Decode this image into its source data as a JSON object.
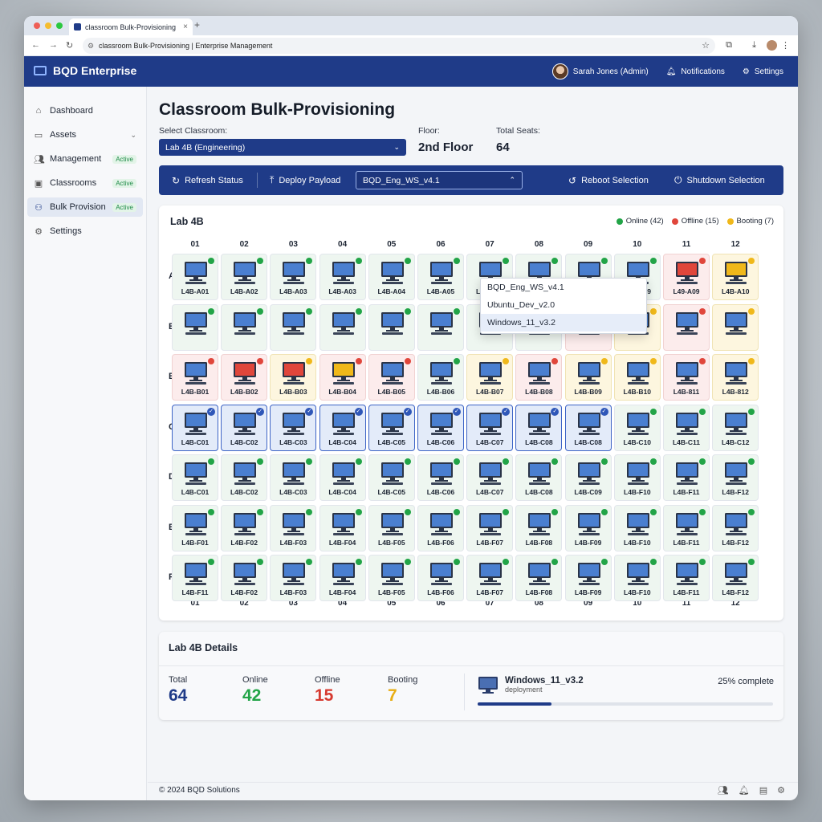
{
  "browser": {
    "tab_title": "classroom Bulk-Provisioning",
    "tab_close": "×",
    "new_tab": "+",
    "url": "classroom Bulk-Provisioning | Enterprise Management"
  },
  "header": {
    "brand": "BQD Enterprise",
    "user": "Sarah Jones (Admin)",
    "notifications": "Notifications",
    "settings": "Settings"
  },
  "sidebar": {
    "items": [
      {
        "label": "Dashboard",
        "icon": "home-icon",
        "badge": ""
      },
      {
        "label": "Assets",
        "icon": "folder-icon",
        "badge": "",
        "chevron": "⌄"
      },
      {
        "label": "Management",
        "icon": "users-icon",
        "badge": "Active"
      },
      {
        "label": "Classrooms",
        "icon": "monitor-icon",
        "badge": "Active"
      },
      {
        "label": "Bulk Provisioning",
        "icon": "network-icon",
        "badge": "Active"
      },
      {
        "label": "Settings",
        "icon": "gear-icon",
        "badge": ""
      }
    ]
  },
  "page": {
    "title": "Classroom Bulk-Provisioning",
    "select_label": "Select Classroom:",
    "selected_classroom": "Lab 4B (Engineering)",
    "floor_label": "Floor:",
    "floor_value": "2nd Floor",
    "seats_label": "Total Seats:",
    "seats_value": "64"
  },
  "toolbar": {
    "refresh": "Refresh Status",
    "deploy": "Deploy Payload",
    "payload_selected": "BQD_Eng_WS_v4.1",
    "payload_options": [
      "BQD_Eng_WS_v4.1",
      "Ubuntu_Dev_v2.0",
      "Windows_11_v3.2"
    ],
    "reboot": "Reboot Selection",
    "shutdown": "Shutdown Selection"
  },
  "grid": {
    "title": "Lab 4B",
    "legend": {
      "online": "Online (42)",
      "offline": "Offline (15)",
      "booting": "Booting (7)"
    },
    "columns": [
      "01",
      "02",
      "03",
      "04",
      "05",
      "06",
      "07",
      "08",
      "09",
      "10",
      "11",
      "12"
    ],
    "rows": [
      {
        "label": "A",
        "seats": [
          {
            "label": "L4B-A01",
            "status": "online"
          },
          {
            "label": "L4B-A02",
            "status": "online"
          },
          {
            "label": "L4B-A03",
            "status": "online"
          },
          {
            "label": "L4B-A03",
            "status": "online"
          },
          {
            "label": "L4B-A04",
            "status": "online"
          },
          {
            "label": "L4B-A05",
            "status": "online"
          },
          {
            "label": "L4B-A06",
            "status": "online"
          },
          {
            "label": "L4B-A07",
            "status": "online"
          },
          {
            "label": "L4B-A08",
            "status": "online"
          },
          {
            "label": "L4B-A09",
            "status": "online"
          },
          {
            "label": "L49-A09",
            "status": "offline",
            "screen": "red"
          },
          {
            "label": "L4B-A10",
            "status": "booting",
            "screen": "yellow"
          }
        ]
      },
      {
        "label": "B",
        "seats": [
          {
            "label": "",
            "status": "online"
          },
          {
            "label": "",
            "status": "online"
          },
          {
            "label": "",
            "status": "online"
          },
          {
            "label": "",
            "status": "online"
          },
          {
            "label": "",
            "status": "online"
          },
          {
            "label": "",
            "status": "online"
          },
          {
            "label": "",
            "status": "online"
          },
          {
            "label": "",
            "status": "online"
          },
          {
            "label": "",
            "status": "offline",
            "screen": "red"
          },
          {
            "label": "",
            "status": "booting"
          },
          {
            "label": "",
            "status": "offline"
          },
          {
            "label": "",
            "status": "booting"
          }
        ]
      },
      {
        "label": "B",
        "seats": [
          {
            "label": "L4B-B01",
            "status": "offline"
          },
          {
            "label": "L4B-B02",
            "status": "offline",
            "screen": "red"
          },
          {
            "label": "L4B-B03",
            "status": "booting",
            "screen": "red"
          },
          {
            "label": "L4B-B04",
            "status": "offline",
            "screen": "yellow"
          },
          {
            "label": "L4B-B05",
            "status": "offline"
          },
          {
            "label": "L4B-B06",
            "status": "online"
          },
          {
            "label": "L4B-B07",
            "status": "booting"
          },
          {
            "label": "L4B-B08",
            "status": "offline"
          },
          {
            "label": "L4B-B09",
            "status": "booting"
          },
          {
            "label": "L4B-B10",
            "status": "booting"
          },
          {
            "label": "L4B-811",
            "status": "offline"
          },
          {
            "label": "L4B-812",
            "status": "booting"
          }
        ]
      },
      {
        "label": "C",
        "seats": [
          {
            "label": "L4B-C01",
            "status": "selected"
          },
          {
            "label": "L4B-C02",
            "status": "selected"
          },
          {
            "label": "L4B-C03",
            "status": "selected"
          },
          {
            "label": "L4B-C04",
            "status": "selected"
          },
          {
            "label": "L4B-C05",
            "status": "selected"
          },
          {
            "label": "L4B-C06",
            "status": "selected"
          },
          {
            "label": "L4B-C07",
            "status": "selected"
          },
          {
            "label": "L4B-C08",
            "status": "selected"
          },
          {
            "label": "L4B-C08",
            "status": "selected"
          },
          {
            "label": "L4B-C10",
            "status": "online"
          },
          {
            "label": "L4B-C11",
            "status": "online"
          },
          {
            "label": "L4B-C12",
            "status": "online"
          }
        ]
      },
      {
        "label": "D",
        "seats": [
          {
            "label": "L4B-C01",
            "status": "online"
          },
          {
            "label": "L4B-C02",
            "status": "online"
          },
          {
            "label": "L4B-C03",
            "status": "online"
          },
          {
            "label": "L4B-C04",
            "status": "online"
          },
          {
            "label": "L4B-C05",
            "status": "online"
          },
          {
            "label": "L4B-C06",
            "status": "online"
          },
          {
            "label": "L4B-C07",
            "status": "online"
          },
          {
            "label": "L4B-C08",
            "status": "online"
          },
          {
            "label": "L4B-C09",
            "status": "online"
          },
          {
            "label": "L4B-F10",
            "status": "online"
          },
          {
            "label": "L4B-F11",
            "status": "online"
          },
          {
            "label": "L4B-F12",
            "status": "online"
          }
        ]
      },
      {
        "label": "E",
        "seats": [
          {
            "label": "L4B-F01",
            "status": "online"
          },
          {
            "label": "L4B-F02",
            "status": "online"
          },
          {
            "label": "L4B-F03",
            "status": "online"
          },
          {
            "label": "L4B-F04",
            "status": "online"
          },
          {
            "label": "L4B-F05",
            "status": "online"
          },
          {
            "label": "L4B-F06",
            "status": "online"
          },
          {
            "label": "L4B-F07",
            "status": "online"
          },
          {
            "label": "L4B-F08",
            "status": "online"
          },
          {
            "label": "L4B-F09",
            "status": "online"
          },
          {
            "label": "L4B-F10",
            "status": "online"
          },
          {
            "label": "L4B-F11",
            "status": "online"
          },
          {
            "label": "L4B-F12",
            "status": "online"
          }
        ]
      },
      {
        "label": "F",
        "seats": [
          {
            "label": "L4B-F11",
            "status": "online"
          },
          {
            "label": "L4B-F02",
            "status": "online"
          },
          {
            "label": "L4B-F03",
            "status": "online"
          },
          {
            "label": "L4B-F04",
            "status": "online"
          },
          {
            "label": "L4B-F05",
            "status": "online"
          },
          {
            "label": "L4B-F06",
            "status": "online"
          },
          {
            "label": "L4B-F07",
            "status": "online"
          },
          {
            "label": "L4B-F08",
            "status": "online"
          },
          {
            "label": "L4B-F09",
            "status": "online"
          },
          {
            "label": "L4B-F10",
            "status": "online"
          },
          {
            "label": "L4B-F11",
            "status": "online"
          },
          {
            "label": "L4B-F12",
            "status": "online"
          }
        ]
      }
    ]
  },
  "details": {
    "title": "Lab 4B Details",
    "total_label": "Total",
    "total_value": "64",
    "online_label": "Online",
    "online_value": "42",
    "offline_label": "Offline",
    "offline_value": "15",
    "booting_label": "Booting",
    "booting_value": "7",
    "deployment_name": "Windows_11_v3.2",
    "deployment_sub": "deployment",
    "progress_text": "25% complete",
    "progress": 0.25
  },
  "footer": {
    "copyright": "© 2024 BQD Solutions"
  },
  "colors": {
    "brand": "#1f3b88",
    "online": "#22a447",
    "offline": "#e0463b",
    "booting": "#f0b81a",
    "screen_blue": "#4a7fd0"
  }
}
